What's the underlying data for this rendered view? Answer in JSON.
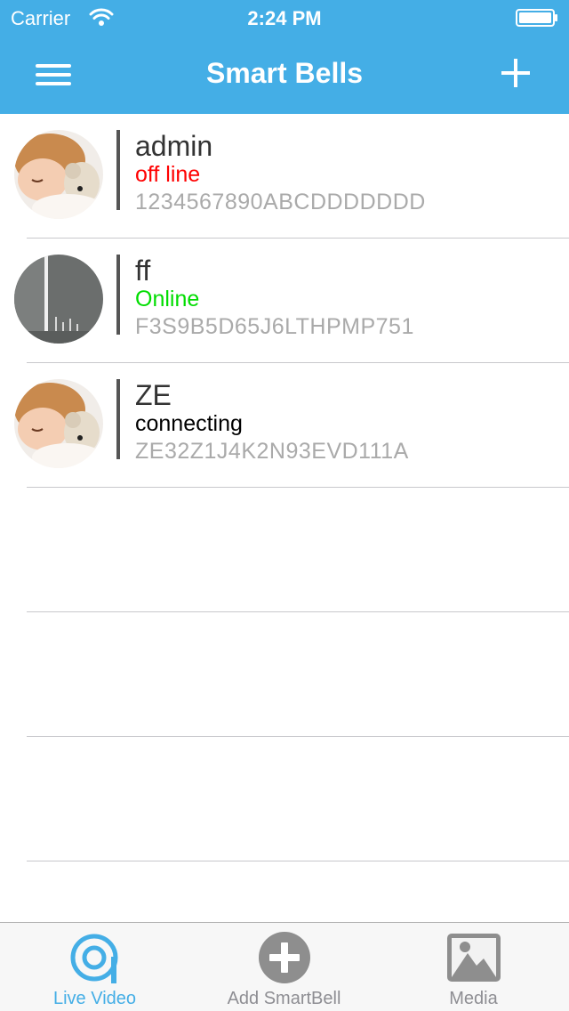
{
  "status_bar": {
    "carrier": "Carrier",
    "time": "2:24 PM"
  },
  "nav": {
    "title": "Smart Bells",
    "menu_icon": "hamburger-icon",
    "add_icon": "plus-icon"
  },
  "devices": [
    {
      "name": "admin",
      "status": "off line",
      "status_color": "#ff0000",
      "serial": "1234567890ABCDDDDDDD",
      "avatar": "child-with-teddy"
    },
    {
      "name": "ff",
      "status": "Online",
      "status_color": "#00dd00",
      "serial": "F3S9B5D65J6LTHPMP751",
      "avatar": "camera-snapshot"
    },
    {
      "name": "ZE",
      "status": "connecting",
      "status_color": "#000000",
      "serial": "ZE32Z1J4K2N93EVD111A",
      "avatar": "child-with-teddy"
    }
  ],
  "tabbar": {
    "accent": "#44aee6",
    "items": [
      {
        "label": "Live Video",
        "icon": "live-video-icon",
        "active": true
      },
      {
        "label": "Add SmartBell",
        "icon": "add-circle-icon",
        "active": false
      },
      {
        "label": "Media",
        "icon": "media-icon",
        "active": false
      }
    ]
  }
}
